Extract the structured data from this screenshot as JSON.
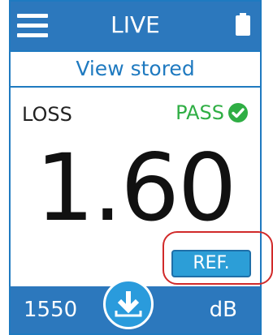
{
  "header": {
    "title": "LIVE",
    "menu_icon": "hamburger-menu-icon",
    "battery_icon": "battery-icon"
  },
  "view_stored_label": "View stored",
  "measurement": {
    "label": "LOSS",
    "status": "PASS",
    "status_icon": "check-circle-icon",
    "value": "1.60",
    "ref_button_label": "REF."
  },
  "footer": {
    "wavelength": "1550",
    "unit": "dB",
    "download_icon": "download-icon"
  },
  "colors": {
    "bar_blue": "#2c78bd",
    "accent_blue": "#1f7ac0",
    "pass_green": "#2fae44",
    "ref_button": "#2c9ed7",
    "highlight_red": "#d12a2a"
  }
}
